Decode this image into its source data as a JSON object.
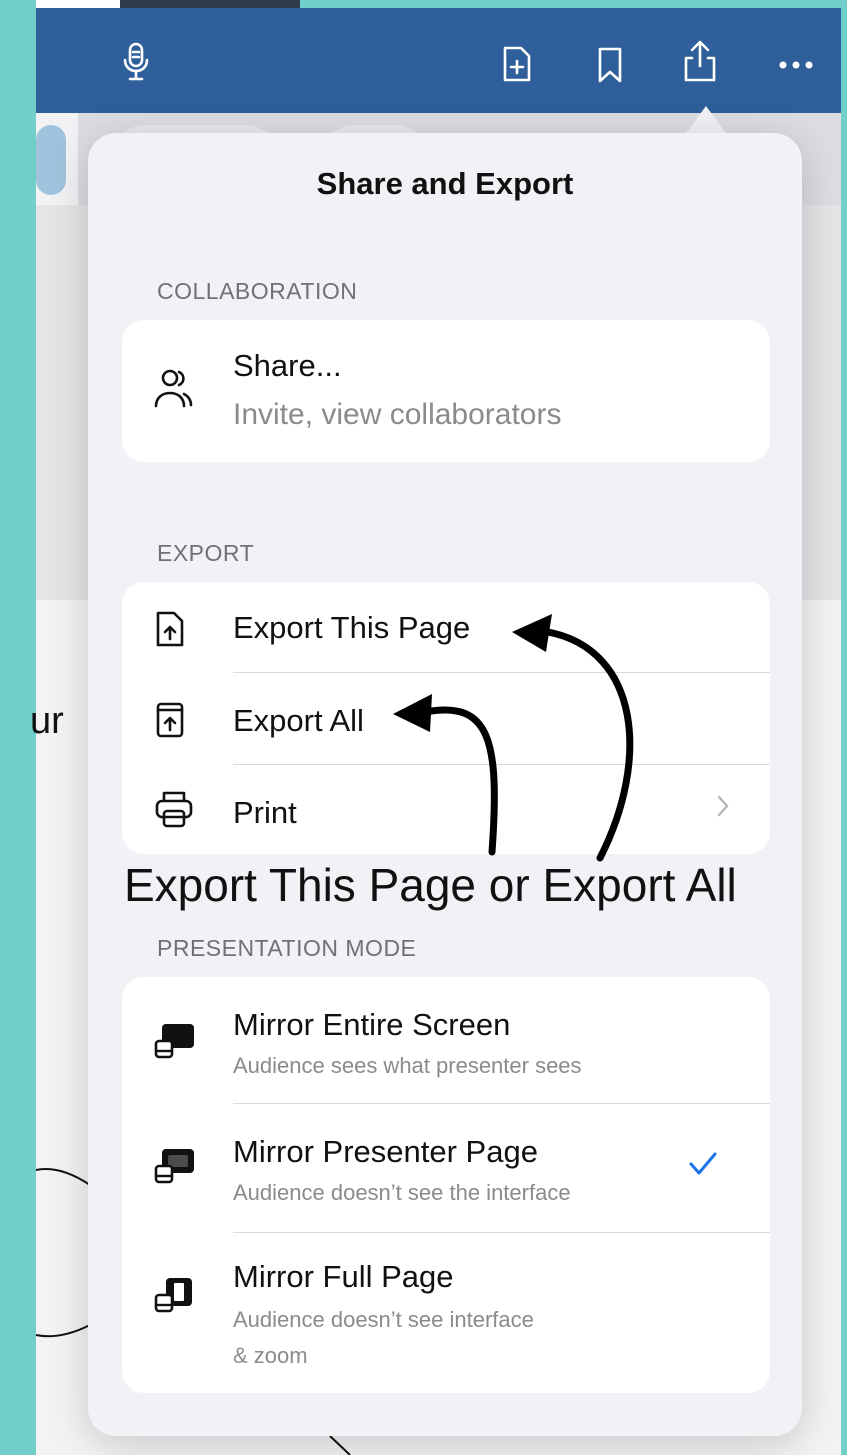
{
  "popover": {
    "title": "Share and Export",
    "sections": {
      "collaboration": {
        "header": "COLLABORATION",
        "share": {
          "label": "Share...",
          "subtitle": "Invite, view collaborators"
        }
      },
      "export": {
        "header": "EXPORT",
        "export_page": "Export This Page",
        "export_all": "Export All",
        "print": "Print"
      },
      "presentation": {
        "header": "PRESENTATION MODE",
        "mirror_entire": {
          "label": "Mirror Entire Screen",
          "subtitle": "Audience sees what presenter sees"
        },
        "mirror_presenter": {
          "label": "Mirror Presenter Page",
          "subtitle": "Audience doesn’t see the interface",
          "selected": true
        },
        "mirror_full": {
          "label": "Mirror Full Page",
          "subtitle_line1": "Audience doesn’t see interface",
          "subtitle_line2": "& zoom"
        }
      }
    }
  },
  "annotation": {
    "caption": "Export This Page or Export All"
  },
  "background": {
    "partial_text": "ur"
  },
  "icons": {
    "toolbar": [
      "microphone-icon",
      "add-page-icon",
      "bookmark-icon",
      "share-icon",
      "more-icon"
    ],
    "rows": [
      "people-icon",
      "export-page-icon",
      "export-all-icon",
      "printer-icon",
      "mirror-screen-icon",
      "mirror-presenter-icon",
      "mirror-full-icon",
      "chevron-right-icon",
      "checkmark-icon"
    ]
  },
  "colors": {
    "toolbar": "#2e5f9a",
    "accent": "#1a73e8",
    "teal_frame": "#70cfc9"
  }
}
